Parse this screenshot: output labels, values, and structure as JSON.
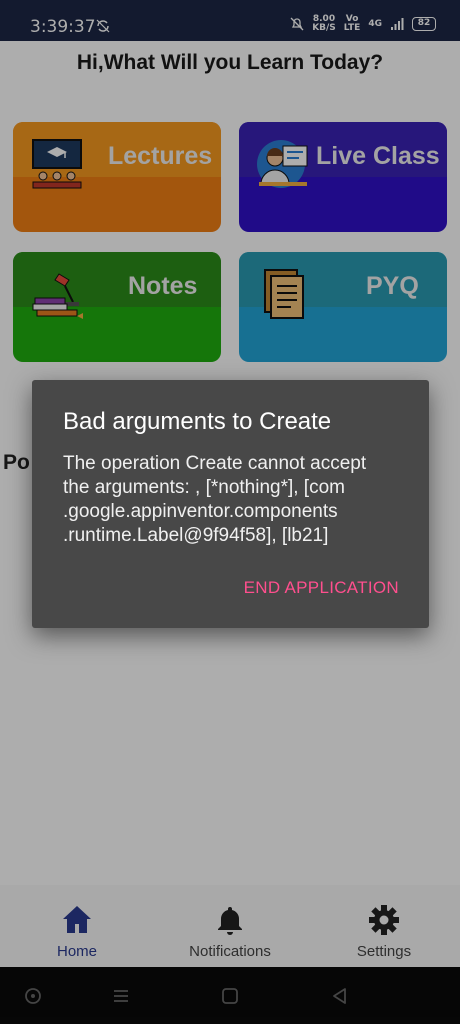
{
  "status_bar": {
    "time": "3:39:37",
    "speed_value": "8.00",
    "speed_unit": "KB/S",
    "network_top": "Vo",
    "network_bottom": "LTE",
    "network_gen": "4G",
    "battery": "82"
  },
  "app": {
    "greeting": "Hi,What Will you Learn Today?",
    "cards": [
      {
        "label": "Lectures",
        "color": "#F07F14",
        "band_color": "#F79A20",
        "icon": "classroom-icon"
      },
      {
        "label": "Live Class",
        "color": "#3011C9",
        "band_color": "#3A22B5",
        "icon": "teacher-icon"
      },
      {
        "label": "Notes",
        "color": "#1FAE10",
        "band_color": "#2C8C1A",
        "icon": "books-lamp-icon"
      },
      {
        "label": "PYQ",
        "color": "#23A6D8",
        "band_color": "#2A9BB3",
        "icon": "document-icon"
      }
    ],
    "partial_text": "Po"
  },
  "bottom_nav": {
    "items": [
      {
        "label": "Home",
        "icon": "home-icon",
        "active": true
      },
      {
        "label": "Notifications",
        "icon": "bell-icon",
        "active": false
      },
      {
        "label": "Settings",
        "icon": "gear-icon",
        "active": false
      }
    ]
  },
  "dialog": {
    "title": "Bad arguments to Create",
    "message": "The operation Create cannot accept\nthe arguments: , [*nothing*], [com\n.google.appinventor.components\n.runtime.Label@9f94f58], [lb21]",
    "button": "END APPLICATION"
  },
  "colors": {
    "dialog_bg": "#484848",
    "accent": "#FF4F8E",
    "nav_active": "#2A3A8F"
  }
}
